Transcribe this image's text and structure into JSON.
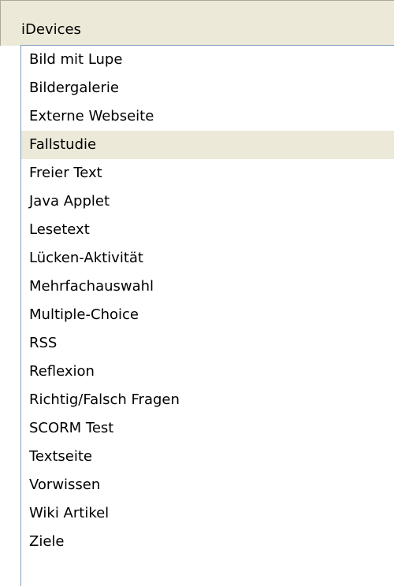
{
  "panel": {
    "title": "iDevices"
  },
  "list": {
    "selected_index": 3,
    "items": [
      {
        "label": "Bild mit Lupe"
      },
      {
        "label": "Bildergalerie"
      },
      {
        "label": "Externe Webseite"
      },
      {
        "label": "Fallstudie"
      },
      {
        "label": "Freier Text"
      },
      {
        "label": "Java Applet"
      },
      {
        "label": "Lesetext"
      },
      {
        "label": "Lücken-Aktivität"
      },
      {
        "label": "Mehrfachauswahl"
      },
      {
        "label": "Multiple-Choice"
      },
      {
        "label": "RSS"
      },
      {
        "label": "Reflexion"
      },
      {
        "label": "Richtig/Falsch Fragen"
      },
      {
        "label": "SCORM Test"
      },
      {
        "label": "Textseite"
      },
      {
        "label": "Vorwissen"
      },
      {
        "label": "Wiki Artikel"
      },
      {
        "label": "Ziele"
      }
    ]
  },
  "colors": {
    "header_background": "#ece9d8",
    "selected_background": "#ece9d8",
    "list_border": "#7f9db9",
    "text": "#000000"
  }
}
